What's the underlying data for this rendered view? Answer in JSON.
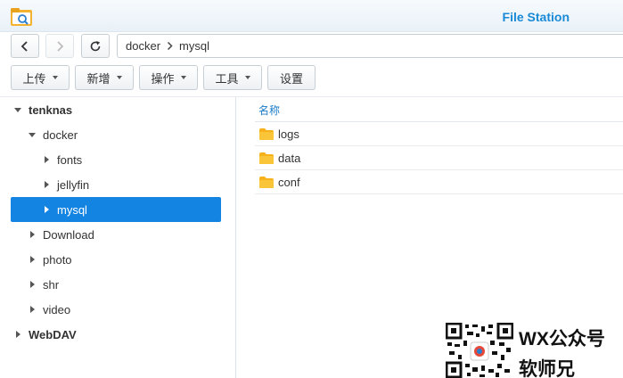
{
  "window": {
    "title": "File Station",
    "icon": "file-station-icon",
    "accent": "#1a8ad6"
  },
  "nav": {
    "back_icon": "chevron-left-icon",
    "forward_icon": "chevron-right-icon",
    "refresh_icon": "refresh-icon",
    "path": [
      "docker",
      "mysql"
    ]
  },
  "toolbar": {
    "upload": "上传",
    "create": "新增",
    "action": "操作",
    "tools": "工具",
    "settings": "设置"
  },
  "tree": {
    "selected_color": "#1484e2",
    "items": [
      {
        "label": "tenknas",
        "level": 0,
        "expanded": true
      },
      {
        "label": "docker",
        "level": 1,
        "expanded": true
      },
      {
        "label": "fonts",
        "level": 2,
        "expanded": false
      },
      {
        "label": "jellyfin",
        "level": 2,
        "expanded": false
      },
      {
        "label": "mysql",
        "level": 2,
        "expanded": false,
        "selected": true
      },
      {
        "label": "Download",
        "level": 1,
        "expanded": false
      },
      {
        "label": "photo",
        "level": 1,
        "expanded": false
      },
      {
        "label": "shr",
        "level": 1,
        "expanded": false
      },
      {
        "label": "video",
        "level": 1,
        "expanded": false
      },
      {
        "label": "WebDAV",
        "level": 0,
        "expanded": false
      }
    ]
  },
  "list": {
    "column_name": "名称",
    "folder_color": "#f7b21b",
    "files": [
      {
        "name": "logs",
        "icon": "folder-icon"
      },
      {
        "name": "data",
        "icon": "folder-icon"
      },
      {
        "name": "conf",
        "icon": "folder-icon"
      }
    ]
  },
  "watermark": {
    "line1": "WX公众号",
    "line2": "软师兄",
    "qr_icon": "qr-code-icon"
  }
}
